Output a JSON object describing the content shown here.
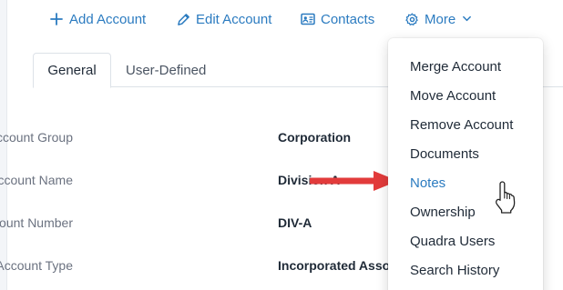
{
  "toolbar": {
    "add_label": "Add Account",
    "edit_label": "Edit Account",
    "contacts_label": "Contacts",
    "more_label": "More"
  },
  "tabs": [
    {
      "label": "General",
      "active": true
    },
    {
      "label": "User-Defined",
      "active": false
    }
  ],
  "fields": [
    {
      "label": "Account Group",
      "value": "Corporation"
    },
    {
      "label": "Account Name",
      "value": "Division A"
    },
    {
      "label": "Account Number",
      "value": "DIV-A"
    },
    {
      "label": "Account Type",
      "value": "Incorporated Association"
    }
  ],
  "more_menu": {
    "items": [
      {
        "label": "Merge Account"
      },
      {
        "label": "Move Account"
      },
      {
        "label": "Remove Account"
      },
      {
        "label": "Documents"
      },
      {
        "label": "Notes",
        "highlighted": true
      },
      {
        "label": "Ownership"
      },
      {
        "label": "Quadra Users"
      },
      {
        "label": "Search History"
      }
    ]
  },
  "colors": {
    "accent": "#2b7bc0",
    "arrow": "#e23b3b",
    "text": "#1f2a37",
    "muted_label": "#6b7280"
  },
  "icons": {
    "add": "plus-icon",
    "edit": "pencil-icon",
    "contacts": "address-card-icon",
    "more": "gear-icon",
    "more_chevron": "chevron-down-icon",
    "pointer": "hand-pointer-cursor-icon",
    "annotation": "red-arrow-icon"
  }
}
